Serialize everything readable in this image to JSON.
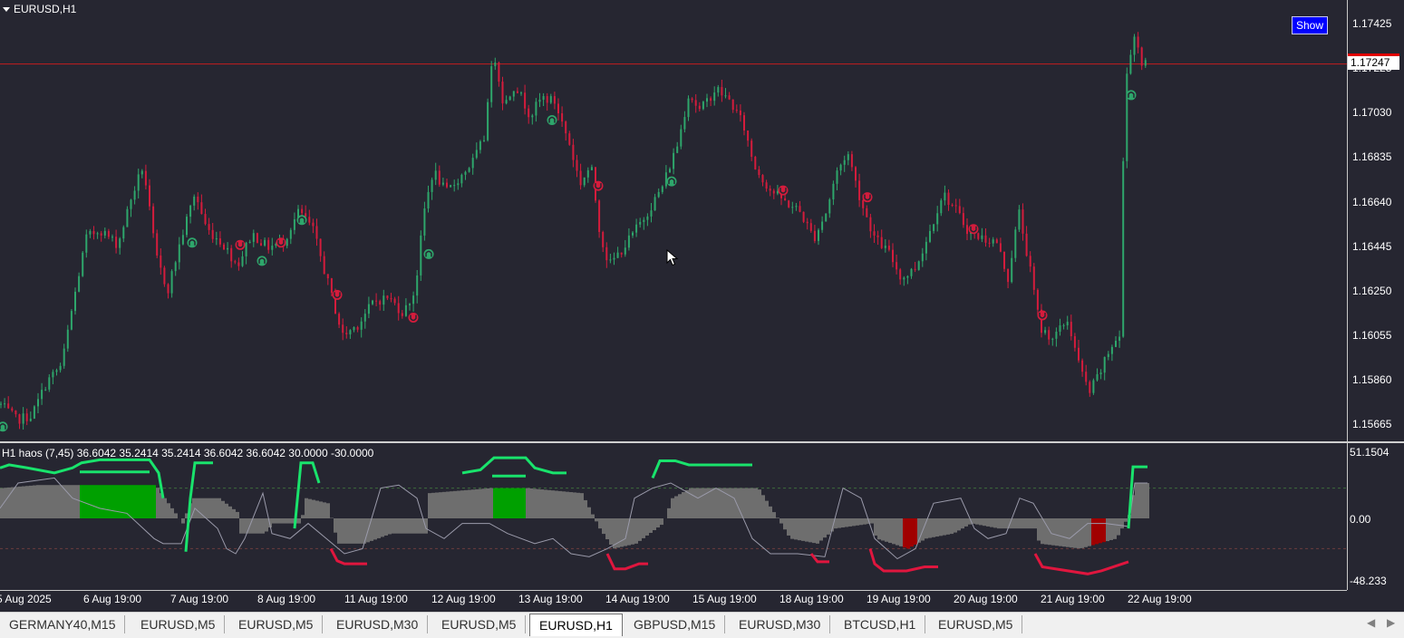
{
  "window": {
    "title": "EURUSD,H1"
  },
  "main_panel": {
    "show_button": "Show",
    "price_axis": [
      "1.17425",
      "1.17225",
      "1.17030",
      "1.16835",
      "1.16640",
      "1.16445",
      "1.16250",
      "1.16055",
      "1.15860",
      "1.15665"
    ],
    "current_price": "1.17247",
    "colors": {
      "background": "#262631",
      "bull": "#2ea66b",
      "bear": "#d41c3c",
      "price_line": "#c41e1e"
    }
  },
  "indicator": {
    "title": "H1 haos  (7,45) 36.6042 35.2414 35.2414 36.6042 36.6042 30.0000 -30.0000",
    "axis": [
      "51.1504",
      "0.00",
      "-48.233"
    ],
    "colors": {
      "up": "#19e36c",
      "down": "#e0163e",
      "histogram": "#6e6e6e",
      "strong_up": "#00a000",
      "strong_down": "#a00000"
    }
  },
  "time_axis": [
    "5 Aug 2025",
    "6 Aug 19:00",
    "7 Aug 19:00",
    "8 Aug 19:00",
    "11 Aug 19:00",
    "12 Aug 19:00",
    "13 Aug 19:00",
    "14 Aug 19:00",
    "15 Aug 19:00",
    "18 Aug 19:00",
    "19 Aug 19:00",
    "20 Aug 19:00",
    "21 Aug 19:00",
    "22 Aug 19:00"
  ],
  "tabs": [
    "GERMANY40,M15",
    "EURUSD,M5",
    "EURUSD,M5",
    "EURUSD,M30",
    "EURUSD,M5",
    "EURUSD,H1",
    "GBPUSD,M15",
    "EURUSD,M30",
    "BTCUSD,H1",
    "EURUSD,M5"
  ],
  "active_tab": "EURUSD,H1",
  "chart_data": {
    "type": "candlestick",
    "symbol": "EURUSD",
    "timeframe": "H1",
    "ylim": [
      1.1555,
      1.175
    ],
    "path": [
      [
        0,
        1.1575
      ],
      [
        18,
        1.1568
      ],
      [
        35,
        1.157
      ],
      [
        52,
        1.1585
      ],
      [
        68,
        1.1592
      ],
      [
        80,
        1.1618
      ],
      [
        95,
        1.1648
      ],
      [
        110,
        1.1652
      ],
      [
        130,
        1.1645
      ],
      [
        145,
        1.1666
      ],
      [
        158,
        1.168
      ],
      [
        172,
        1.164
      ],
      [
        185,
        1.1625
      ],
      [
        200,
        1.1648
      ],
      [
        215,
        1.1668
      ],
      [
        228,
        1.1652
      ],
      [
        245,
        1.1646
      ],
      [
        262,
        1.1636
      ],
      [
        278,
        1.165
      ],
      [
        295,
        1.1644
      ],
      [
        312,
        1.1646
      ],
      [
        330,
        1.166
      ],
      [
        345,
        1.1652
      ],
      [
        362,
        1.1628
      ],
      [
        378,
        1.1605
      ],
      [
        395,
        1.161
      ],
      [
        412,
        1.162
      ],
      [
        428,
        1.1622
      ],
      [
        445,
        1.1615
      ],
      [
        458,
        1.1625
      ],
      [
        468,
        1.166
      ],
      [
        478,
        1.1678
      ],
      [
        492,
        1.1668
      ],
      [
        508,
        1.1675
      ],
      [
        522,
        1.1682
      ],
      [
        534,
        1.1692
      ],
      [
        540,
        1.1718
      ],
      [
        546,
        1.1728
      ],
      [
        556,
        1.1706
      ],
      [
        568,
        1.1716
      ],
      [
        585,
        1.1702
      ],
      [
        598,
        1.171
      ],
      [
        612,
        1.1708
      ],
      [
        628,
        1.169
      ],
      [
        640,
        1.1672
      ],
      [
        652,
        1.168
      ],
      [
        662,
        1.165
      ],
      [
        672,
        1.1636
      ],
      [
        690,
        1.1645
      ],
      [
        712,
        1.1658
      ],
      [
        730,
        1.167
      ],
      [
        748,
        1.169
      ],
      [
        760,
        1.1712
      ],
      [
        772,
        1.1704
      ],
      [
        790,
        1.1714
      ],
      [
        806,
        1.1708
      ],
      [
        820,
        1.1698
      ],
      [
        832,
        1.168
      ],
      [
        848,
        1.167
      ],
      [
        866,
        1.1664
      ],
      [
        882,
        1.166
      ],
      [
        898,
        1.1648
      ],
      [
        912,
        1.166
      ],
      [
        922,
        1.1676
      ],
      [
        935,
        1.1686
      ],
      [
        950,
        1.1664
      ],
      [
        965,
        1.1648
      ],
      [
        980,
        1.1642
      ],
      [
        995,
        1.163
      ],
      [
        1010,
        1.1635
      ],
      [
        1025,
        1.165
      ],
      [
        1040,
        1.1668
      ],
      [
        1055,
        1.166
      ],
      [
        1070,
        1.165
      ],
      [
        1085,
        1.1648
      ],
      [
        1100,
        1.1646
      ],
      [
        1112,
        1.163
      ],
      [
        1124,
        1.166
      ],
      [
        1136,
        1.1635
      ],
      [
        1148,
        1.1608
      ],
      [
        1162,
        1.1604
      ],
      [
        1178,
        1.1612
      ],
      [
        1192,
        1.159
      ],
      [
        1202,
        1.158
      ],
      [
        1215,
        1.159
      ],
      [
        1228,
        1.1602
      ],
      [
        1236,
        1.1605
      ],
      [
        1240,
        1.17
      ],
      [
        1244,
        1.1725
      ],
      [
        1252,
        1.1738
      ],
      [
        1260,
        1.1725
      ],
      [
        1266,
        1.1724
      ]
    ],
    "signals": [
      {
        "x": 3,
        "y": 1.1565,
        "dir": "up"
      },
      {
        "x": 212,
        "y": 1.1646,
        "dir": "up"
      },
      {
        "x": 265,
        "y": 1.1645,
        "dir": "down"
      },
      {
        "x": 289,
        "y": 1.1638,
        "dir": "up"
      },
      {
        "x": 310,
        "y": 1.1646,
        "dir": "down"
      },
      {
        "x": 333,
        "y": 1.1656,
        "dir": "up"
      },
      {
        "x": 372,
        "y": 1.1623,
        "dir": "down"
      },
      {
        "x": 456,
        "y": 1.1613,
        "dir": "down"
      },
      {
        "x": 473,
        "y": 1.1641,
        "dir": "up"
      },
      {
        "x": 609,
        "y": 1.17,
        "dir": "up"
      },
      {
        "x": 660,
        "y": 1.1671,
        "dir": "down"
      },
      {
        "x": 741,
        "y": 1.1673,
        "dir": "up"
      },
      {
        "x": 864,
        "y": 1.1669,
        "dir": "down"
      },
      {
        "x": 957,
        "y": 1.1666,
        "dir": "down"
      },
      {
        "x": 1074,
        "y": 1.1652,
        "dir": "down"
      },
      {
        "x": 1150,
        "y": 1.1614,
        "dir": "down"
      },
      {
        "x": 1248,
        "y": 1.1711,
        "dir": "up"
      }
    ]
  }
}
